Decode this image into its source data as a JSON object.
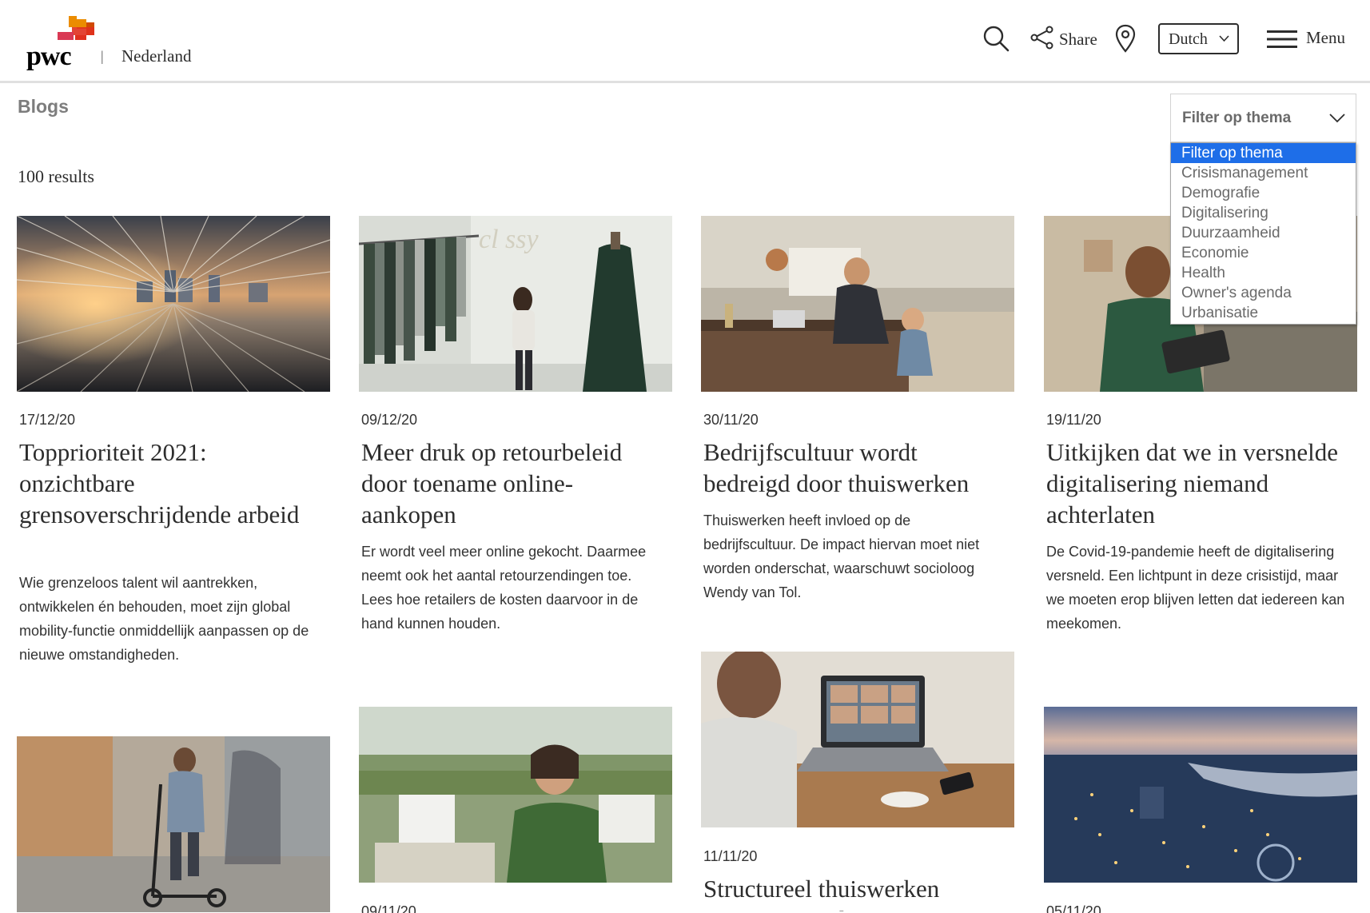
{
  "header": {
    "logo_text": "pwc",
    "separator": "|",
    "country": "Nederland",
    "share_label": "Share",
    "language": "Dutch",
    "menu_label": "Menu"
  },
  "page": {
    "title": "Blogs",
    "results": "100 results"
  },
  "filter": {
    "label": "Filter op thema",
    "options": [
      "Filter op thema",
      "Crisismanagement",
      "Demografie",
      "Digitalisering",
      "Duurzaamheid",
      "Economie",
      "Health",
      "Owner's agenda",
      "Urbanisatie"
    ],
    "selected": "Filter op thema"
  },
  "cards": [
    {
      "date": "17/12/20",
      "title": "Topprioriteit 2021: onzichtbare grensoverschrijdende arbeid",
      "description": "Wie grenzeloos talent wil aantrekken, ontwikkelen én behouden, moet zijn global mobility-functie onmiddellijk aanpassen op de nieuwe omstandigheden."
    },
    {
      "date": "09/12/20",
      "title": "Meer druk op retourbeleid door toename online-aankopen",
      "description": "Er wordt veel meer online gekocht. Daarmee neemt ook het aantal retourzendingen toe. Lees hoe retailers de kosten daarvoor in de hand kunnen houden."
    },
    {
      "date": "30/11/20",
      "title": "Bedrijfscultuur wordt bedreigd door thuiswerken",
      "description": "Thuiswerken heeft invloed op de bedrijfscultuur. De impact hiervan moet niet worden onderschat, waarschuwt socioloog Wendy van Tol."
    },
    {
      "date": "19/11/20",
      "title": "Uitkijken dat we in versnelde digitalisering niemand achterlaten",
      "description": "De Covid-19-pandemie heeft de digitalisering versneld. Een lichtpunt in deze crisistijd, maar we moeten erop blijven letten dat iedereen kan meekomen."
    },
    {
      "date": "09/11/20"
    },
    {
      "date": "11/11/20",
      "title": "Structureel thuiswerken vraagt om andere omgang"
    },
    {
      "date": "05/11/20"
    }
  ],
  "colors": {
    "select_highlight": "#1e6ee8",
    "logo_orange": "#e0301e",
    "logo_amber": "#eb8c00",
    "title_gray": "#7d7d7d"
  }
}
